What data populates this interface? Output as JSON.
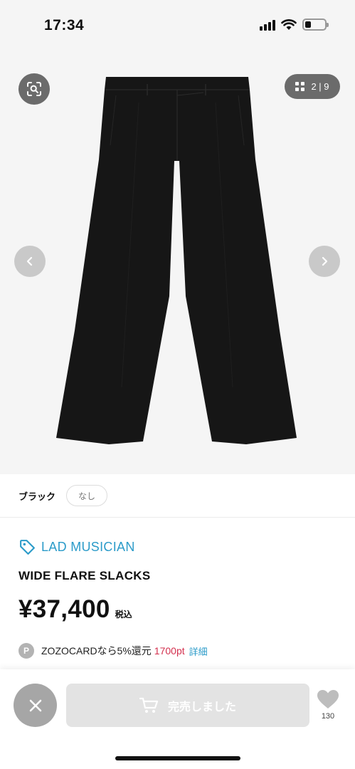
{
  "status_bar": {
    "time": "17:34"
  },
  "gallery": {
    "counter": "2 | 9",
    "visual_search_icon": "scan-search-icon",
    "prev_icon": "chevron-left-icon",
    "next_icon": "chevron-right-icon"
  },
  "color_option": {
    "color": "ブラック",
    "size": "なし"
  },
  "product": {
    "brand": "LAD MUSICIAN",
    "brand_icon": "tag-icon",
    "name": "WIDE FLARE SLACKS",
    "price": "¥37,400",
    "tax_label": "税込"
  },
  "points": {
    "icon_label": "P",
    "text": "ZOZOCARDなら5%還元",
    "value": "1700pt",
    "detail_link": "詳細"
  },
  "bottom_bar": {
    "cart_label": "完売しました",
    "favorite_count": "130",
    "cart_icon": "cart-icon",
    "favorite_icon": "heart-icon",
    "close_icon": "close-icon"
  },
  "colors": {
    "accent_blue": "#2b9bc9",
    "points_red": "#d3304e",
    "disabled_gray": "#e3e3e3",
    "gallery_bg": "#f5f5f5"
  }
}
